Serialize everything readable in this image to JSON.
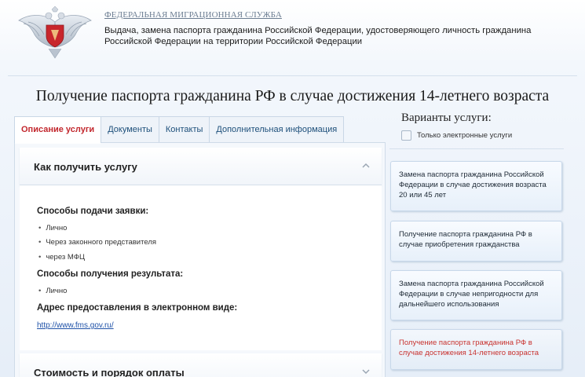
{
  "header": {
    "agency": "ФЕДЕРАЛЬНАЯ МИГРАЦИОННАЯ СЛУЖБА",
    "service_line1": "Выдача, замена паспорта гражданина Российской Федерации, удостоверяющего личность гражданина",
    "service_line2": "Российской Федерации на территории Российской Федерации",
    "emblem_icon": "double-headed-eagle-icon"
  },
  "page_title": "Получение паспорта гражданина РФ в случае достижения 14-летнего возраста",
  "tabs": [
    {
      "label": "Описание услуги",
      "active": true
    },
    {
      "label": "Документы",
      "active": false
    },
    {
      "label": "Контакты",
      "active": false
    },
    {
      "label": "Дополнительная информация",
      "active": false
    }
  ],
  "accordion": {
    "how_to_title": "Как получить услугу",
    "submit_title": "Способы подачи заявки:",
    "submit_items": [
      "Лично",
      "Через законного представителя",
      "через МФЦ"
    ],
    "result_title": "Способы получения результата:",
    "result_items": [
      "Лично"
    ],
    "address_title": "Адрес предоставления в электронном виде:",
    "address_link": "http://www.fms.gov.ru/",
    "cost_title": "Стоимость и порядок оплаты"
  },
  "variants": {
    "title": "Варианты услуги:",
    "filter_label": "Только электронные услуги",
    "filter_checked": false,
    "items": [
      {
        "label": "Замена паспорта гражданина Российской Федерации в случае достижения возраста 20 или 45 лет"
      },
      {
        "label": "Получение паспорта гражданина РФ в случае приобретения гражданства"
      },
      {
        "label": "Замена паспорта гражданина Российской Федерации в случае непригодности для дальнейшего использования"
      },
      {
        "label": "Получение паспорта гражданина РФ в случае достижения 14-летнего возраста",
        "current": true
      }
    ]
  },
  "colors": {
    "active_tab": "#c2272d",
    "link": "#1f52a8",
    "tab_text": "#1d4f7a"
  }
}
